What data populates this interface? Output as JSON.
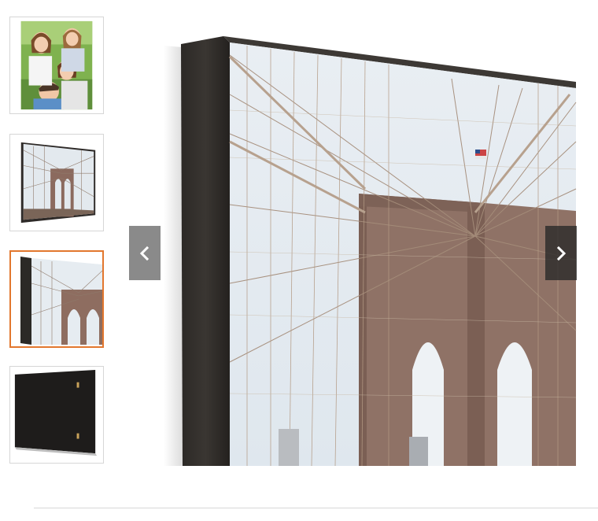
{
  "gallery": {
    "thumbnails": [
      {
        "name": "family-photo",
        "active": false
      },
      {
        "name": "bridge-panel-angle",
        "active": false
      },
      {
        "name": "bridge-panel-edge",
        "active": true
      },
      {
        "name": "panel-back",
        "active": false
      }
    ],
    "active_index": 2,
    "accent_color": "#e2772e"
  },
  "viewer": {
    "prev_icon": "chevron-left-icon",
    "next_icon": "chevron-right-icon"
  }
}
